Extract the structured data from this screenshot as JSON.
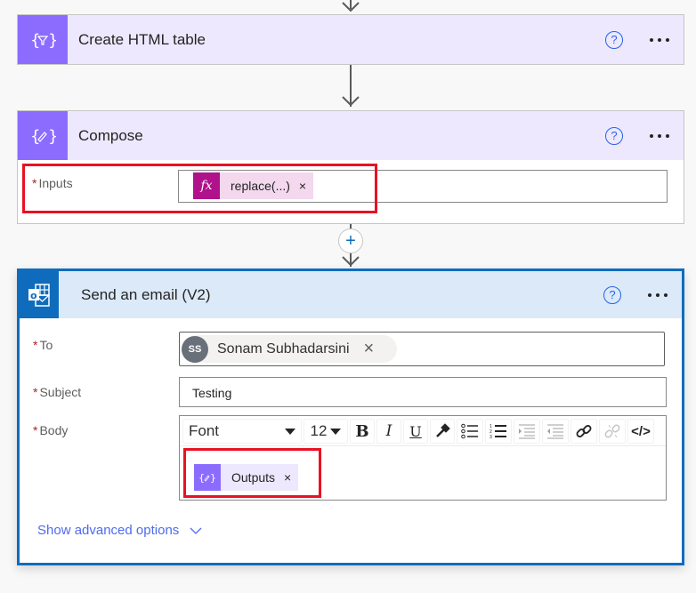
{
  "flow": {
    "steps": [
      {
        "id": "create-html-table",
        "title": "Create HTML table",
        "icon": "data-operation-icon",
        "accent": "#8c6cff",
        "header_bg": "#ede8fd"
      },
      {
        "id": "compose",
        "title": "Compose",
        "icon": "compose-icon",
        "accent": "#8c6cff",
        "header_bg": "#ede8fd",
        "fields": [
          {
            "label": "Inputs",
            "required": true,
            "required_marker": "*",
            "token": {
              "label": "replace(...)",
              "icon": "fx-icon",
              "icon_text": "fx",
              "color": "#b0128c",
              "bg": "#f3d8ee",
              "remove": "×"
            }
          }
        ]
      },
      {
        "id": "send-email",
        "title": "Send an email (V2)",
        "icon": "outlook-icon",
        "accent": "#0f6cbd",
        "header_bg": "#dbe9f8",
        "fields": [
          {
            "label": "To",
            "required": true,
            "required_marker": "*",
            "recipient": {
              "initials": "SS",
              "name": "Sonam Subhadarsini",
              "remove": "×"
            }
          },
          {
            "label": "Subject",
            "required": true,
            "required_marker": "*",
            "value": "Testing"
          },
          {
            "label": "Body",
            "required": true,
            "required_marker": "*",
            "toolbar": {
              "font": "Font",
              "font_size": "12",
              "buttons": [
                "bold",
                "italic",
                "underline",
                "color",
                "bullet-list",
                "numbered-list",
                "indent",
                "outdent",
                "link",
                "unlink",
                "code-view"
              ],
              "bold_label": "B",
              "italic_label": "I",
              "underline_label": "U",
              "code_label": "</>"
            },
            "token": {
              "label": "Outputs",
              "icon": "compose-icon",
              "color": "#8c6cff",
              "bg": "#ede8fd",
              "remove": "×"
            }
          }
        ],
        "advanced_link": "Show advanced options"
      }
    ],
    "help_symbol": "?",
    "add_step_symbol": "+"
  },
  "highlight_color": "#e81123",
  "link_color": "#4f6bed"
}
